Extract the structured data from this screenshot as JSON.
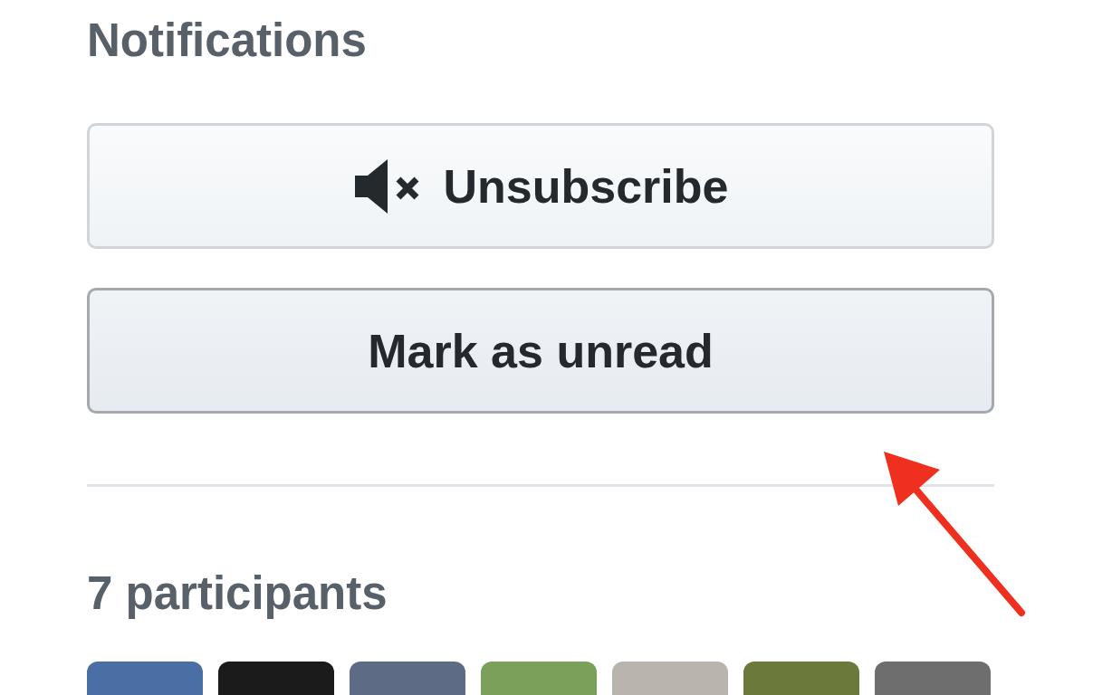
{
  "notifications": {
    "heading": "Notifications",
    "buttons": [
      {
        "label": "Unsubscribe",
        "kind": "mute",
        "hovered": false
      },
      {
        "label": "Mark as unread",
        "kind": "plain",
        "hovered": true
      }
    ]
  },
  "participants": {
    "heading": "7 participants"
  }
}
